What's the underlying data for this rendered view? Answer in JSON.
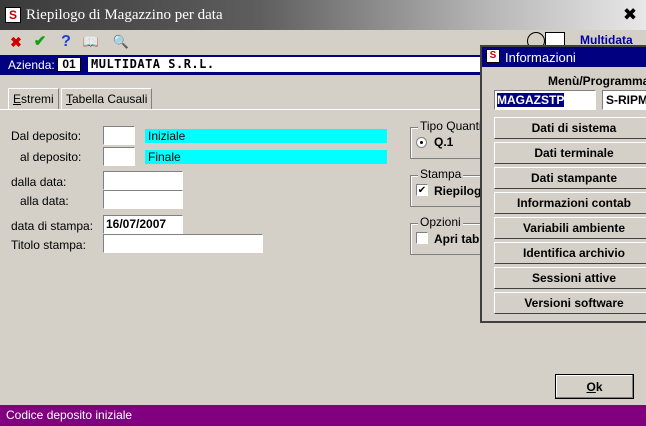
{
  "window": {
    "title": "Riepilogo di Magazzino per data",
    "close_glyph": "✖",
    "icon_letter": "S"
  },
  "toolbar": {
    "cancel_icon": "✖",
    "confirm_icon": "✔",
    "help_icon": "?",
    "book_icon": "📖",
    "search_icon": "🔍"
  },
  "azienda": {
    "label": "Azienda:",
    "code": "01",
    "name": "MULTIDATA S.R.L."
  },
  "tabs": [
    {
      "label_u": "E",
      "label_rest": "stremi"
    },
    {
      "label_u": "T",
      "label_rest": "abella Causali"
    }
  ],
  "form": {
    "dal_deposito_label": "Dal deposito:",
    "dal_deposito_value": "",
    "dal_deposito_desc": "Iniziale",
    "al_deposito_label": "al deposito:",
    "al_deposito_value": "",
    "al_deposito_desc": "Finale",
    "dalla_data_label": "dalla data:",
    "dalla_data_value": "",
    "alla_data_label": "alla data:",
    "alla_data_value": "",
    "data_stampa_label": "data di stampa:",
    "data_stampa_value": "16/07/2007",
    "titolo_label": "Titolo stampa:",
    "titolo_value": ""
  },
  "tipo_quantita": {
    "title": "Tipo Quantit",
    "option": "Q.1"
  },
  "stampa": {
    "title": "Stampa",
    "option": "Riepilog",
    "checked_glyph": "✔"
  },
  "opzioni": {
    "title": "Opzioni",
    "option": "Apri tab"
  },
  "ok_button": {
    "label_u": "O",
    "label_rest": "k"
  },
  "status_text": "Codice deposito iniziale",
  "info_dialog": {
    "title": "Informazioni",
    "menu_label": "Menù/Programma",
    "menu_value": "MAGAZSTP",
    "program_value": "S-RIPM",
    "buttons": [
      "Dati di sistema",
      "Dati terminale",
      "Dati stampante",
      "Informazioni contab",
      "Variabili ambiente",
      "Identifica archivio",
      "Sessioni attive",
      "Versioni software"
    ]
  },
  "background_header_text": "Multidata"
}
